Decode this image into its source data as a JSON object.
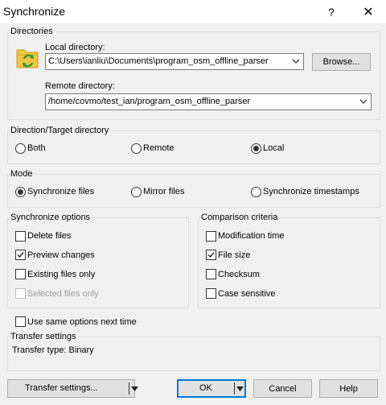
{
  "window": {
    "title": "Synchronize",
    "help": "?",
    "close": "✕"
  },
  "directories": {
    "group": "Directories",
    "local_label": "Local directory:",
    "local_value": "C:\\Users\\ianliu\\Documents\\program_osm_offline_parser",
    "browse": "Browse...",
    "remote_label": "Remote directory:",
    "remote_value": "/home/covmo/test_ian/program_osm_offline_parser"
  },
  "direction": {
    "group": "Direction/Target directory",
    "options": [
      {
        "label": "Both",
        "selected": false
      },
      {
        "label": "Remote",
        "selected": false
      },
      {
        "label": "Local",
        "selected": true
      }
    ]
  },
  "mode": {
    "group": "Mode",
    "options": [
      {
        "label": "Synchronize files",
        "selected": true
      },
      {
        "label": "Mirror files",
        "selected": false
      },
      {
        "label": "Synchronize timestamps",
        "selected": false
      }
    ]
  },
  "sync_options": {
    "group": "Synchronize options",
    "items": [
      {
        "label": "Delete files",
        "checked": false,
        "enabled": true
      },
      {
        "label": "Preview changes",
        "checked": true,
        "enabled": true
      },
      {
        "label": "Existing files only",
        "checked": false,
        "enabled": true
      },
      {
        "label": "Selected files only",
        "checked": false,
        "enabled": false
      }
    ]
  },
  "comparison": {
    "group": "Comparison criteria",
    "items": [
      {
        "label": "Modification time",
        "checked": false
      },
      {
        "label": "File size",
        "checked": true
      },
      {
        "label": "Checksum",
        "checked": false
      },
      {
        "label": "Case sensitive",
        "checked": false
      }
    ]
  },
  "same_options": {
    "label": "Use same options next time",
    "checked": false
  },
  "transfer": {
    "group": "Transfer settings",
    "type_text": "Transfer type: Binary"
  },
  "buttons": {
    "transfer_settings": "Transfer settings...",
    "ok": "OK",
    "cancel": "Cancel",
    "help": "Help"
  },
  "colors": {
    "folder": "#f4c542",
    "sync_arrows": "#2e9c2e",
    "accent": "#0078d7"
  }
}
